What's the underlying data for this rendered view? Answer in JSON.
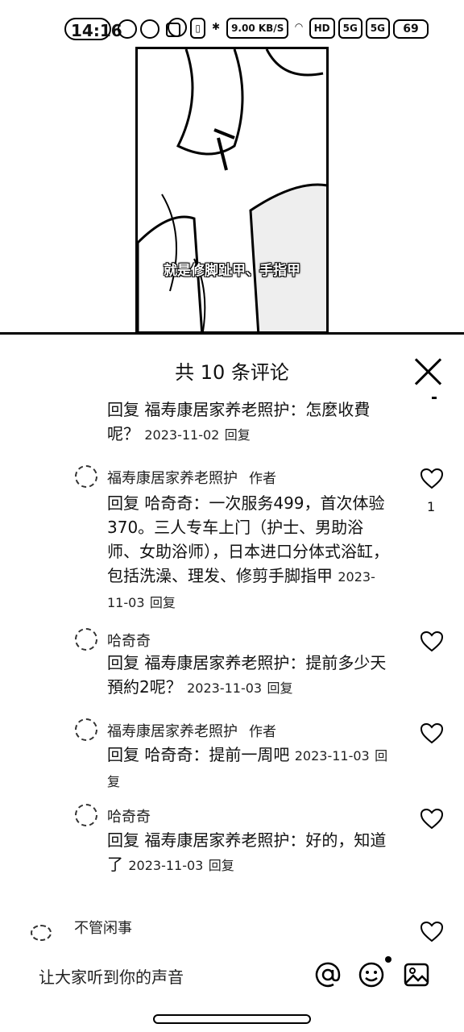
{
  "status_bar": {
    "time": "14:16",
    "net_speed": "9.00 KB/S",
    "hd": "HD",
    "sig1": "5G",
    "sig2": "5G",
    "battery": "69"
  },
  "video": {
    "subtitle": "就是修脚趾甲、手指甲"
  },
  "comments_panel": {
    "title": "共 10 条评论",
    "items": [
      {
        "body": "回复  福寿康居家养老照护：怎麼收費呢？",
        "date": "2023-11-02",
        "reply_label": "回复"
      },
      {
        "user": "福寿康居家养老照护",
        "tag": "作者",
        "body": "回复  哈奇奇：一次服务499，首次体验370。三人专车上门（护士、男助浴师、女助浴师），日本进口分体式浴缸，包括洗澡、理发、修剪手脚指甲",
        "date": "2023-11-03",
        "reply_label": "回复",
        "likes": "1"
      },
      {
        "user": "哈奇奇",
        "body": "回复  福寿康居家养老照护：提前多少天預約2呢？",
        "date": "2023-11-03",
        "reply_label": "回复"
      },
      {
        "user": "福寿康居家养老照护",
        "tag": "作者",
        "body": "回复  哈奇奇：提前一周吧",
        "date": "2023-11-03",
        "reply_label": "回复"
      },
      {
        "user": "哈奇奇",
        "body": "回复  福寿康居家养老照护：好的，知道了",
        "date": "2023-11-03",
        "reply_label": "回复"
      }
    ],
    "next_comment": {
      "user": "不管闲事"
    }
  },
  "input_bar": {
    "placeholder": "让大家听到你的声音"
  },
  "icons": [
    "close-icon",
    "heart-icon",
    "at-icon",
    "emoji-icon",
    "image-icon"
  ]
}
